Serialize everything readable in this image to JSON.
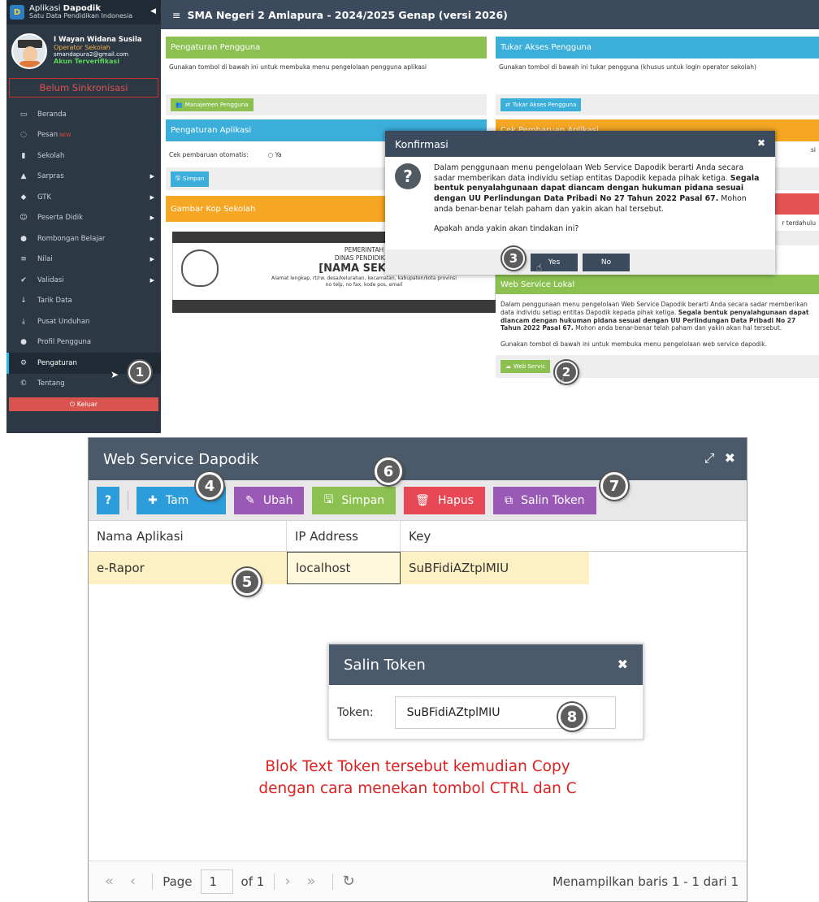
{
  "sidebar": {
    "app_title_prefix": "Aplikasi",
    "app_title_bold": "Dapodik",
    "app_subtitle": "Satu Data Pendidikan Indonesia",
    "user_name": "I Wayan Widana Susila",
    "user_role": "Operator Sekolah",
    "user_email": "smandapura2@gmail.com",
    "user_status": "Akun Terverifikasi",
    "sync_status": "Belum Sinkronisasi",
    "menu": [
      {
        "label": "Beranda",
        "icon": "monitor-icon"
      },
      {
        "label": "Pesan",
        "badge": "NEW",
        "icon": "chat-icon"
      },
      {
        "label": "Sekolah",
        "icon": "building-icon"
      },
      {
        "label": "Sarpras",
        "icon": "road-icon"
      },
      {
        "label": "GTK",
        "icon": "graduation-icon"
      },
      {
        "label": "Peserta Didik",
        "icon": "smile-icon"
      },
      {
        "label": "Rombongan Belajar",
        "icon": "group-icon"
      },
      {
        "label": "Nilai",
        "icon": "list-icon"
      },
      {
        "label": "Validasi",
        "icon": "check-icon"
      },
      {
        "label": "Tarik Data",
        "icon": "arrow-down-icon"
      },
      {
        "label": "Pusat Unduhan",
        "icon": "download-icon"
      },
      {
        "label": "Profil Pengguna",
        "icon": "user-icon"
      },
      {
        "label": "Pengaturan",
        "icon": "gears-icon"
      },
      {
        "label": "Tentang",
        "icon": "copyright-icon"
      }
    ],
    "logout_label": "Keluar"
  },
  "topbar": {
    "title": "SMA Negeri 2 Amlapura - 2024/2025 Genap (versi 2026)"
  },
  "panels": {
    "pengaturan_pengguna": {
      "title": "Pengaturan Pengguna",
      "desc": "Gunakan tombol di bawah ini untuk membuka menu pengelolaan pengguna aplikasi",
      "button": "Manajemen Pengguna"
    },
    "tukar_akses": {
      "title": "Tukar Akses Pengguna",
      "desc": "Gunakan tombol di bawah ini tukar pengguna (khusus untuk login operator sekolah)",
      "button": "Tukar Akses Pengguna"
    },
    "pengaturan_aplikasi": {
      "title": "Pengaturan Aplikasi",
      "label": "Cek pembaruan otomatis:",
      "option_ya": "Ya",
      "button": "Simpan"
    },
    "cek_pembaruan": {
      "title": "Cek Pembaruan Aplikasi",
      "side_text": "si"
    },
    "kop_sekolah": {
      "title": "Gambar Kop Sekolah",
      "line1": "PEMERINTAH",
      "line2": "DINAS PENDIDIKAN",
      "line3": "[NAMA SEKOLA",
      "line4": "Alamat lengkap, rt/rw. desa/kelurahan, kecamatan, kabupaten/kota provinsi",
      "line5": "no telp, no fax, kode pos, email"
    },
    "red_panel": {
      "side_text": "r terdahulu"
    },
    "web_service_lokal": {
      "title": "Web Service Lokal",
      "desc_normal": "Dalam penggunaan menu pengelolaan Web Service Dapodik berarti Anda secara sadar memberikan data individu setiap entitas Dapodik kepada pihak ketiga.",
      "desc_bold": "Segala bentuk penyalahgunaan dapat diancam dengan hukuman pidana sesuai dengan UU Perlindungan Data Pribadi No 27 Tahun 2022 Pasal 67.",
      "desc_tail": "Mohon anda benar-benar telah paham dan yakin akan hal tersebut.",
      "instruction": "Gunakan tombol di bawah ini untuk membuka menu pengelolaan web service dapodik.",
      "button": "Web Servic"
    }
  },
  "konfirmasi": {
    "title": "Konfirmasi",
    "text_normal": "Dalam penggunaan menu pengelolaan Web Service Dapodik berarti Anda secara sadar memberikan data individu setiap entitas Dapodik kepada pihak ketiga.",
    "text_bold": "Segala bentuk penyalahgunaan dapat diancam dengan hukuman pidana sesuai dengan UU Perlindungan Data Pribadi No 27 Tahun 2022 Pasal 67.",
    "text_tail": "Mohon anda benar-benar telah paham dan yakin akan hal tersebut.",
    "question": "Apakah anda yakin akan tindakan ini?",
    "yes_label": "Yes",
    "no_label": "No"
  },
  "web_service_window": {
    "title": "Web Service Dapodik",
    "toolbar": {
      "tambah": "Tam",
      "ubah": "Ubah",
      "simpan": "Simpan",
      "hapus": "Hapus",
      "salin_token": "Salin Token"
    },
    "columns": [
      "Nama Aplikasi",
      "IP Address",
      "Key"
    ],
    "rows": [
      {
        "nama": "e-Rapor",
        "ip": "localhost",
        "key": "SuBFidiAZtplMIU"
      }
    ],
    "pager": {
      "page_label": "Page",
      "page_value": "1",
      "of_label": "of 1",
      "status": "Menampilkan baris 1 - 1 dari 1"
    }
  },
  "salin_token": {
    "title": "Salin Token",
    "label": "Token:",
    "value": "SuBFidiAZtplMIU"
  },
  "instruction": {
    "line1": "Blok Text Token tersebut kemudian Copy",
    "line2": "dengan cara menekan tombol CTRL dan C"
  },
  "steps": [
    "1",
    "2",
    "3",
    "4",
    "5",
    "6",
    "7",
    "8"
  ],
  "colors": {
    "sidebar_bg": "#2c3844",
    "header_bg": "#3b4a5c",
    "green": "#8cc152",
    "blue": "#3bafda",
    "orange": "#f5a623",
    "red": "#e55353"
  }
}
